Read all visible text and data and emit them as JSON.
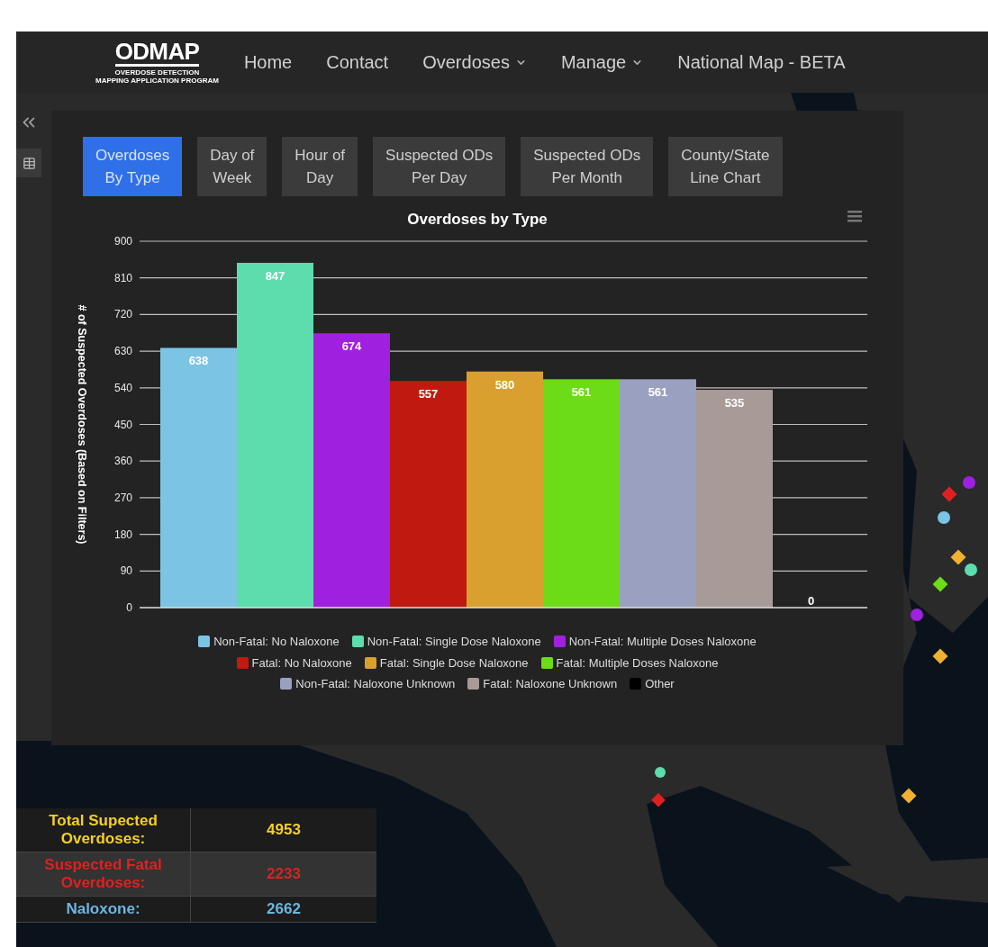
{
  "nav": {
    "logo": {
      "title": "ODMAP",
      "line_1": "OVERDOSE DETECTION",
      "line_2": "MAPPING APPLICATION PROGRAM"
    },
    "items": [
      {
        "label": "Home",
        "dropdown": false
      },
      {
        "label": "Contact",
        "dropdown": false
      },
      {
        "label": "Overdoses",
        "dropdown": true
      },
      {
        "label": "Manage",
        "dropdown": true
      },
      {
        "label": "National Map - BETA",
        "dropdown": false
      }
    ]
  },
  "chart_panel": {
    "tabs": [
      {
        "label": "Overdoses\nBy Type",
        "selected": true
      },
      {
        "label": "Day of\nWeek",
        "selected": false
      },
      {
        "label": "Hour of\nDay",
        "selected": false
      },
      {
        "label": "Suspected ODs\nPer Day",
        "selected": false
      },
      {
        "label": "Suspected ODs\nPer Month",
        "selected": false
      },
      {
        "label": "County/State\nLine Chart",
        "selected": false
      }
    ],
    "chart_data": {
      "type": "bar",
      "title": "Overdoses by Type",
      "ylabel": "# of Suspected Overdoses (Based on Filters)",
      "ylim": [
        0,
        900
      ],
      "yticks": [
        0,
        90,
        180,
        270,
        360,
        450,
        540,
        630,
        720,
        810,
        900
      ],
      "value_labels": [
        "638",
        "847",
        "674",
        "557",
        "580",
        "561",
        "561",
        "535",
        "0"
      ],
      "grid": true,
      "series": [
        {
          "name": "Non-Fatal: No Naloxone",
          "color": "#7cc4e4",
          "values": [
            638
          ]
        },
        {
          "name": "Non-Fatal: Single Dose Naloxone",
          "color": "#5ddcad",
          "values": [
            847
          ]
        },
        {
          "name": "Non-Fatal: Multiple Doses Naloxone",
          "color": "#a020e0",
          "values": [
            674
          ]
        },
        {
          "name": "Fatal: No Naloxone",
          "color": "#c01a10",
          "values": [
            557
          ]
        },
        {
          "name": "Fatal: Single Dose Naloxone",
          "color": "#d9a030",
          "values": [
            580
          ]
        },
        {
          "name": "Fatal: Multiple Doses Naloxone",
          "color": "#6cdc18",
          "values": [
            561
          ]
        },
        {
          "name": "Non-Fatal: Naloxone Unknown",
          "color": "#9aa0c0",
          "values": [
            561
          ]
        },
        {
          "name": "Fatal: Naloxone Unknown",
          "color": "#a89a96",
          "values": [
            535
          ]
        },
        {
          "name": "Other",
          "color": "#000000",
          "values": [
            0
          ]
        }
      ]
    }
  },
  "stats": [
    {
      "label": "Total Supected Overdoses:",
      "value": "4953",
      "color": "#f5d020"
    },
    {
      "label": "Suspected Fatal Overdoses:",
      "value": "2233",
      "color": "#e02020"
    },
    {
      "label": "Naloxone:",
      "value": "2662",
      "color": "#6cb6e0"
    }
  ]
}
